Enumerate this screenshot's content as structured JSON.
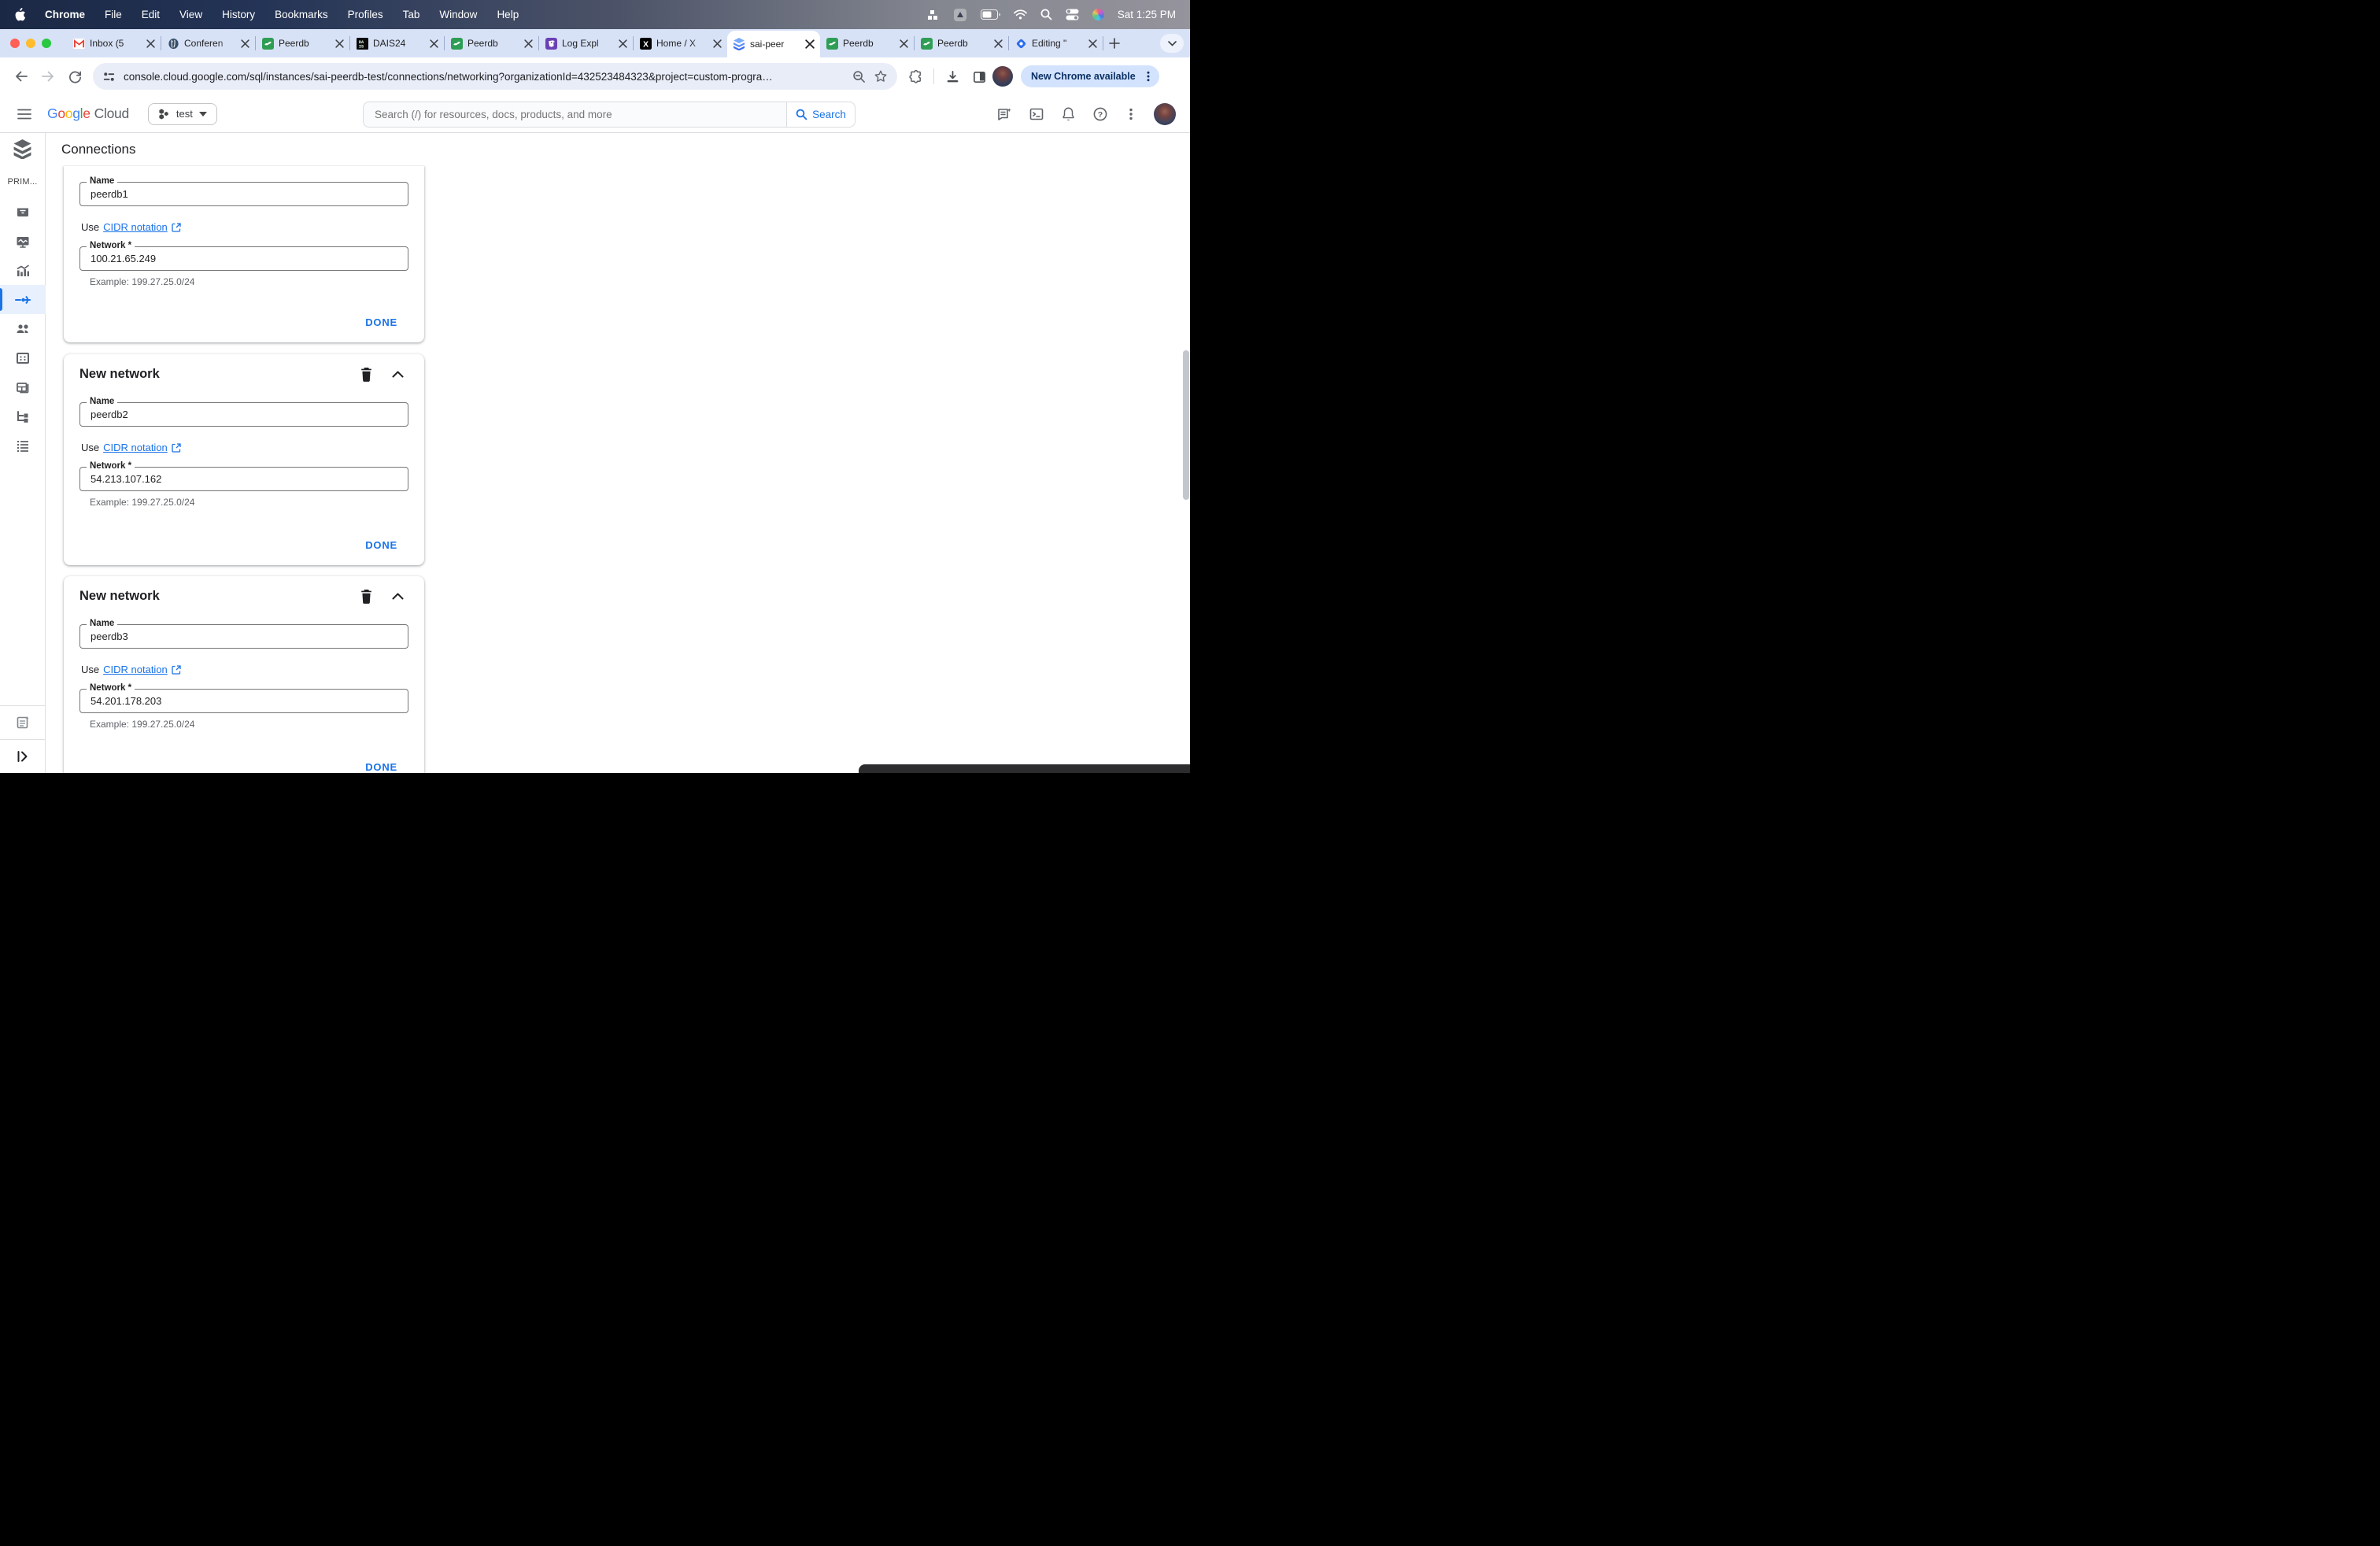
{
  "menubar": {
    "items": [
      "Chrome",
      "File",
      "Edit",
      "View",
      "History",
      "Bookmarks",
      "Profiles",
      "Tab",
      "Window",
      "Help"
    ],
    "clock": "Sat 1:25 PM"
  },
  "tabs": [
    {
      "icon": "gmail",
      "label": "Inbox (5"
    },
    {
      "icon": "postgresql",
      "label": "Conferen"
    },
    {
      "icon": "peerdb",
      "label": "Peerdb"
    },
    {
      "icon": "dais",
      "label": "DAIS24"
    },
    {
      "icon": "peerdb",
      "label": "Peerdb"
    },
    {
      "icon": "datadog",
      "label": "Log Expl"
    },
    {
      "icon": "x",
      "label": "Home / X"
    },
    {
      "icon": "cloud-sql",
      "label": "sai-peer",
      "active": true
    },
    {
      "icon": "peerdb",
      "label": "Peerdb"
    },
    {
      "icon": "peerdb",
      "label": "Peerdb"
    },
    {
      "icon": "editing-pin",
      "label": "Editing \""
    }
  ],
  "toolbar": {
    "url": "console.cloud.google.com/sql/instances/sai-peerdb-test/connections/networking?organizationId=432523484323&project=custom-progra…",
    "update_chip": "New Chrome available"
  },
  "gc_header": {
    "project": "test",
    "search_placeholder": "Search (/) for resources, docs, products, and more",
    "search_button": "Search"
  },
  "sidebar": {
    "section": "PRIM...",
    "items": [
      "overview",
      "observability",
      "system-insights",
      "connections",
      "users",
      "databases",
      "backups",
      "replicas",
      "operations"
    ],
    "active_item": "connections"
  },
  "page": {
    "title": "Connections"
  },
  "cards": [
    {
      "name_label": "Name",
      "name_value": "peerdb1",
      "use_text": "Use",
      "cidr_link": "CIDR notation",
      "network_label": "Network *",
      "network_value": "100.21.65.249",
      "example": "Example: 199.27.25.0/24",
      "done": "DONE"
    },
    {
      "heading": "New network",
      "name_label": "Name",
      "name_value": "peerdb2",
      "use_text": "Use",
      "cidr_link": "CIDR notation",
      "network_label": "Network *",
      "network_value": "54.213.107.162",
      "example": "Example: 199.27.25.0/24",
      "done": "DONE"
    },
    {
      "heading": "New network",
      "name_label": "Name",
      "name_value": "peerdb3",
      "use_text": "Use",
      "cidr_link": "CIDR notation",
      "network_label": "Network *",
      "network_value": "54.201.178.203",
      "example": "Example: 199.27.25.0/24",
      "done": "DONE"
    }
  ]
}
